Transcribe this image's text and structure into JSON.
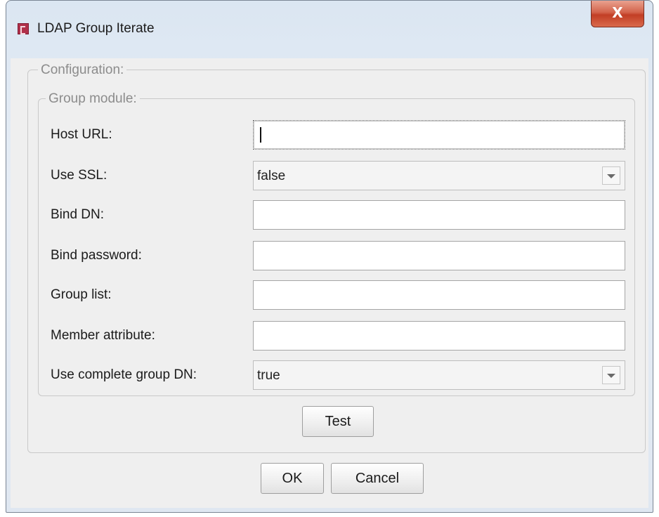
{
  "window": {
    "title": "LDAP Group Iterate",
    "close_glyph": "X",
    "icon": "app-logo-icon"
  },
  "configuration": {
    "legend": "Configuration:",
    "group_module": {
      "legend": "Group module:",
      "host_url": {
        "label": "Host URL:",
        "value": ""
      },
      "use_ssl": {
        "label": "Use SSL:",
        "value": "false"
      },
      "bind_dn": {
        "label": "Bind DN:",
        "value": ""
      },
      "bind_password": {
        "label": "Bind password:",
        "value": ""
      },
      "group_list": {
        "label": "Group list:",
        "value": ""
      },
      "member_attribute": {
        "label": "Member attribute:",
        "value": ""
      },
      "use_complete_group_dn": {
        "label": "Use complete group DN:",
        "value": "true"
      }
    },
    "test_label": "Test"
  },
  "buttons": {
    "ok": "OK",
    "cancel": "Cancel"
  }
}
